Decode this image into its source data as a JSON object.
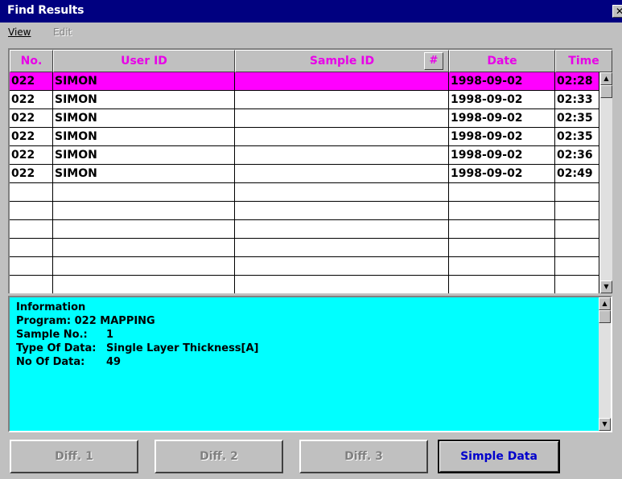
{
  "window": {
    "title": "Find Results",
    "close_label": "✕"
  },
  "menu": {
    "view": "View",
    "edit": "Edit"
  },
  "columns": {
    "no": "No.",
    "user_id": "User ID",
    "sample_id": "Sample ID",
    "hash": "#",
    "date": "Date",
    "time": "Time"
  },
  "rows": [
    {
      "no": "022",
      "user_id": "SIMON",
      "sample_id": "",
      "date": "1998-09-02",
      "time": "02:28",
      "selected": true
    },
    {
      "no": "022",
      "user_id": "SIMON",
      "sample_id": "",
      "date": "1998-09-02",
      "time": "02:33"
    },
    {
      "no": "022",
      "user_id": "SIMON",
      "sample_id": "",
      "date": "1998-09-02",
      "time": "02:35"
    },
    {
      "no": "022",
      "user_id": "SIMON",
      "sample_id": "",
      "date": "1998-09-02",
      "time": "02:35"
    },
    {
      "no": "022",
      "user_id": "SIMON",
      "sample_id": "",
      "date": "1998-09-02",
      "time": "02:36"
    },
    {
      "no": "022",
      "user_id": "SIMON",
      "sample_id": "",
      "date": "1998-09-02",
      "time": "02:49"
    },
    {
      "no": "",
      "user_id": "",
      "sample_id": "",
      "date": "",
      "time": ""
    },
    {
      "no": "",
      "user_id": "",
      "sample_id": "",
      "date": "",
      "time": ""
    },
    {
      "no": "",
      "user_id": "",
      "sample_id": "",
      "date": "",
      "time": ""
    },
    {
      "no": "",
      "user_id": "",
      "sample_id": "",
      "date": "",
      "time": ""
    },
    {
      "no": "",
      "user_id": "",
      "sample_id": "",
      "date": "",
      "time": ""
    },
    {
      "no": "",
      "user_id": "",
      "sample_id": "",
      "date": "",
      "time": ""
    }
  ],
  "info": {
    "heading": "Information",
    "program": "Program: 022 MAPPING",
    "sample_no_label": "Sample No.:",
    "sample_no_value": "1",
    "type_label": "Type Of Data:",
    "type_value": "Single Layer Thickness[A]",
    "count_label": "No Of Data:",
    "count_value": "49"
  },
  "buttons": {
    "diff1": "Diff. 1",
    "diff2": "Diff. 2",
    "diff3": "Diff. 3",
    "simple": "Simple Data"
  },
  "colors": {
    "title_bar": "#000080",
    "header_text": "#e800e8",
    "selected_row": "#ff00ff",
    "info_bg": "#00ffff",
    "active_button_text": "#0000cc"
  },
  "icons": {
    "close": "close-icon",
    "scroll_up": "scroll-up-arrow-icon",
    "scroll_down": "scroll-down-arrow-icon"
  }
}
